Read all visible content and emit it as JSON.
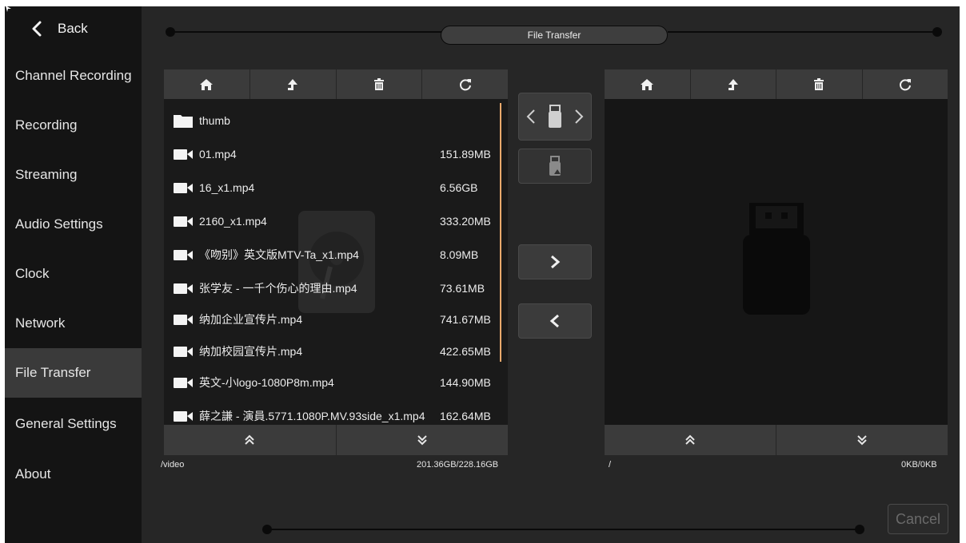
{
  "sidebar": {
    "back_label": "Back",
    "items": [
      {
        "label": "Channel Recording"
      },
      {
        "label": "Recording"
      },
      {
        "label": "Streaming"
      },
      {
        "label": "Audio Settings"
      },
      {
        "label": "Clock"
      },
      {
        "label": "Network"
      },
      {
        "label": "File Transfer"
      },
      {
        "label": "General Settings"
      },
      {
        "label": "About"
      }
    ],
    "active_item": "File Transfer"
  },
  "header": {
    "title": "File Transfer"
  },
  "left_panel": {
    "toolbar_icons": [
      "home-icon",
      "upload-icon",
      "trash-icon",
      "refresh-icon"
    ],
    "files": [
      {
        "name": "thumb",
        "size": "",
        "type": "folder"
      },
      {
        "name": "01.mp4",
        "size": "151.89MB",
        "type": "video"
      },
      {
        "name": "16_x1.mp4",
        "size": "6.56GB",
        "type": "video"
      },
      {
        "name": "2160_x1.mp4",
        "size": "333.20MB",
        "type": "video"
      },
      {
        "name": "《吻别》英文版MTV-Ta_x1.mp4",
        "size": "8.09MB",
        "type": "video"
      },
      {
        "name": "张学友 - 一千个伤心的理由.mp4",
        "size": "73.61MB",
        "type": "video"
      },
      {
        "name": "纳加企业宣传片.mp4",
        "size": "741.67MB",
        "type": "video"
      },
      {
        "name": "纳加校园宣传片.mp4",
        "size": "422.65MB",
        "type": "video"
      },
      {
        "name": "英文-小logo-1080P8m.mp4",
        "size": "144.90MB",
        "type": "video"
      },
      {
        "name": "薛之謙 - 演員.5771.1080P.MV.93side_x1.mp4",
        "size": "162.64MB",
        "type": "video"
      }
    ],
    "path": "/video",
    "capacity": "201.36GB/228.16GB"
  },
  "right_panel": {
    "toolbar_icons": [
      "home-icon",
      "upload-icon",
      "trash-icon",
      "refresh-icon"
    ],
    "path": "/",
    "capacity": "0KB/0KB"
  },
  "actions": {
    "cancel_label": "Cancel"
  },
  "colors": {
    "sidebar_bg": "#141414",
    "main_bg": "#262626",
    "panel_bg": "#1a1a1a",
    "button_bg": "#3b3b3b",
    "scroll_accent": "#e9a96c"
  }
}
